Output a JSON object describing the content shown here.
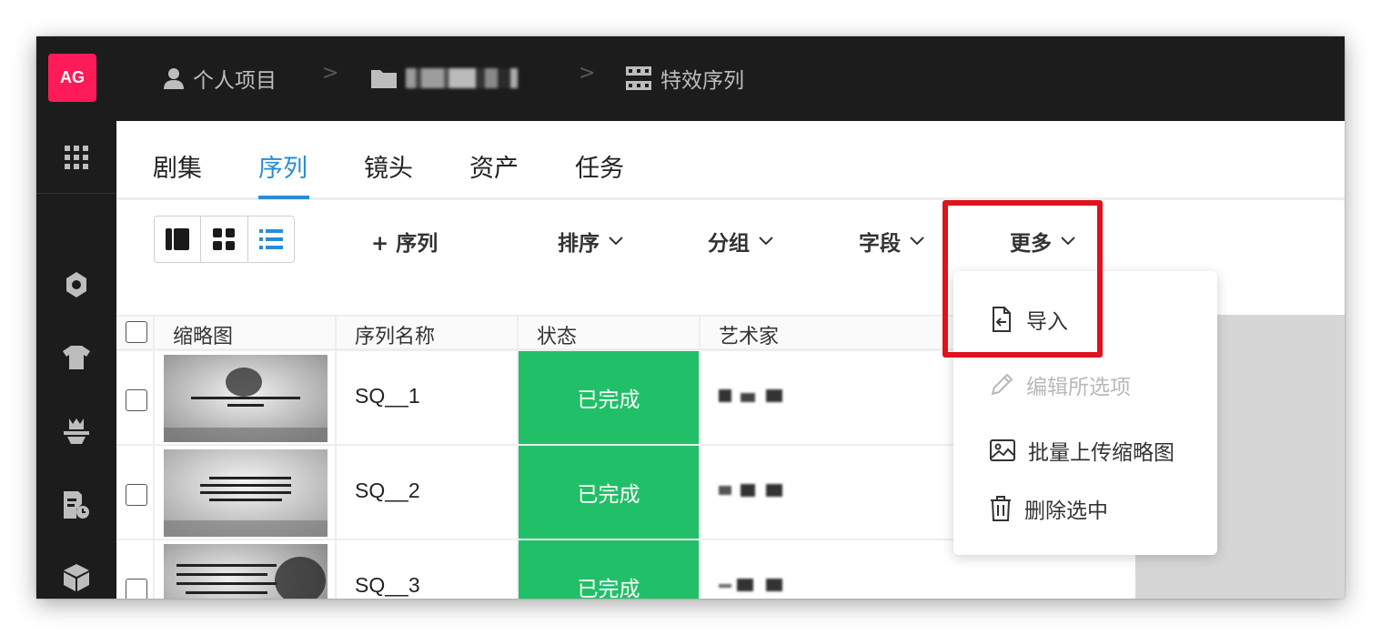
{
  "logo": "AG",
  "breadcrumb": {
    "personal": "个人项目",
    "separator": ">",
    "sequence": "特效序列"
  },
  "tabs": [
    "剧集",
    "序列",
    "镜头",
    "资产",
    "任务"
  ],
  "active_tab": "序列",
  "toolbar": {
    "add_sequence": "+ 序列",
    "sort": "排序",
    "group": "分组",
    "fields": "字段",
    "more": "更多"
  },
  "table": {
    "headers": [
      "缩略图",
      "序列名称",
      "状态",
      "艺术家"
    ],
    "rows": [
      {
        "name": "SQ__1",
        "status": "已完成"
      },
      {
        "name": "SQ__2",
        "status": "已完成"
      },
      {
        "name": "SQ__3",
        "status": "已完成"
      }
    ]
  },
  "menu": {
    "import": "导入",
    "edit_selected": "编辑所选项",
    "batch_upload": "批量上传缩略图",
    "delete_selected": "删除选中"
  },
  "colors": {
    "accent": "#2a8cd6",
    "logo": "#ff1b58",
    "status_done": "#21c068",
    "highlight": "#e0121c",
    "dark_bg": "#1c1c1c"
  }
}
